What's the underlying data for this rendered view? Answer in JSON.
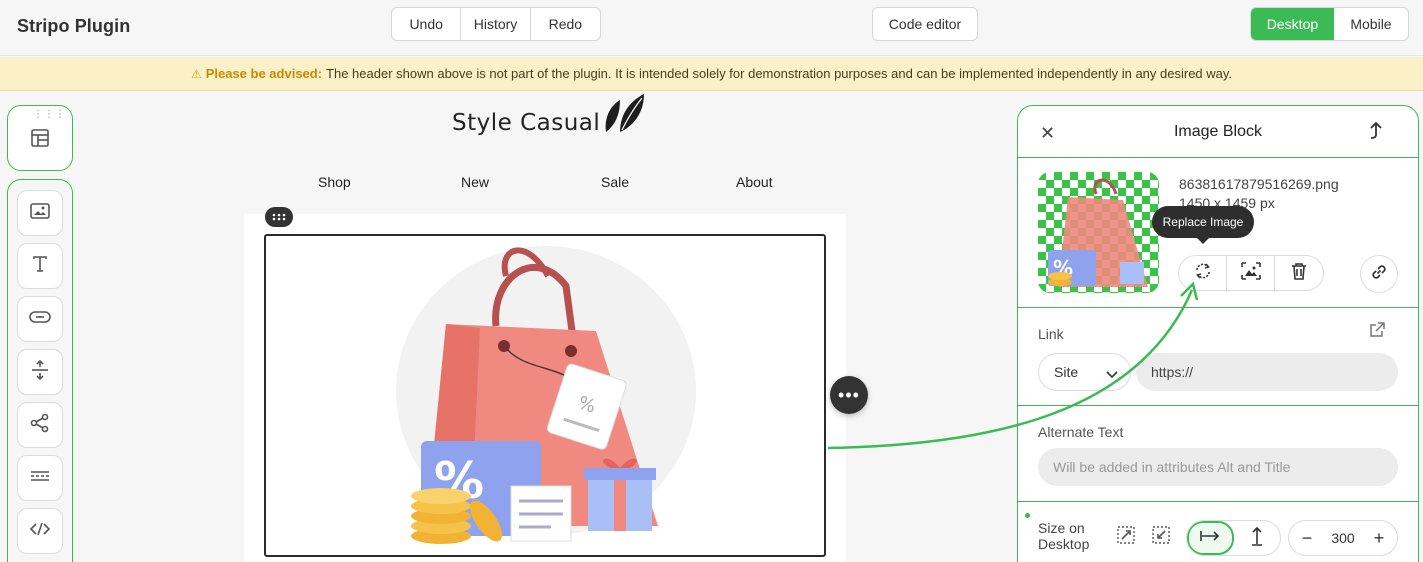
{
  "header": {
    "app_title": "Stripo Plugin",
    "undo_label": "Undo",
    "history_label": "History",
    "redo_label": "Redo",
    "code_editor_label": "Code editor",
    "desktop_label": "Desktop",
    "mobile_label": "Mobile",
    "accent_color": "#3cba55"
  },
  "advisory": {
    "warn_icon": "⚠",
    "strong_text": "Please be advised:",
    "message": "The header shown above is not part of the plugin. It is intended solely for demonstration purposes and can be implemented independently in any desired way."
  },
  "toolbar": {
    "blocks": [
      "image-icon",
      "text-icon",
      "button-icon",
      "spacer-icon",
      "social-icon",
      "divider-icon",
      "html-icon"
    ]
  },
  "email": {
    "brand": "Style Casual",
    "nav": [
      "Shop",
      "New",
      "Sale",
      "About"
    ],
    "more_glyph": "•••"
  },
  "panel": {
    "title": "Image Block",
    "close_glyph": "✕",
    "file_name": "86381617879516269.png",
    "file_dim": "1450 x 1459 px",
    "tooltip": "Replace Image",
    "link_label": "Link",
    "link_type": "Site",
    "link_value": "https://",
    "alt_label": "Alternate Text",
    "alt_placeholder": "Will be added in attributes Alt and Title",
    "size_label": "Size on Desktop",
    "size_value": "300",
    "minus": "−",
    "plus": "+"
  }
}
